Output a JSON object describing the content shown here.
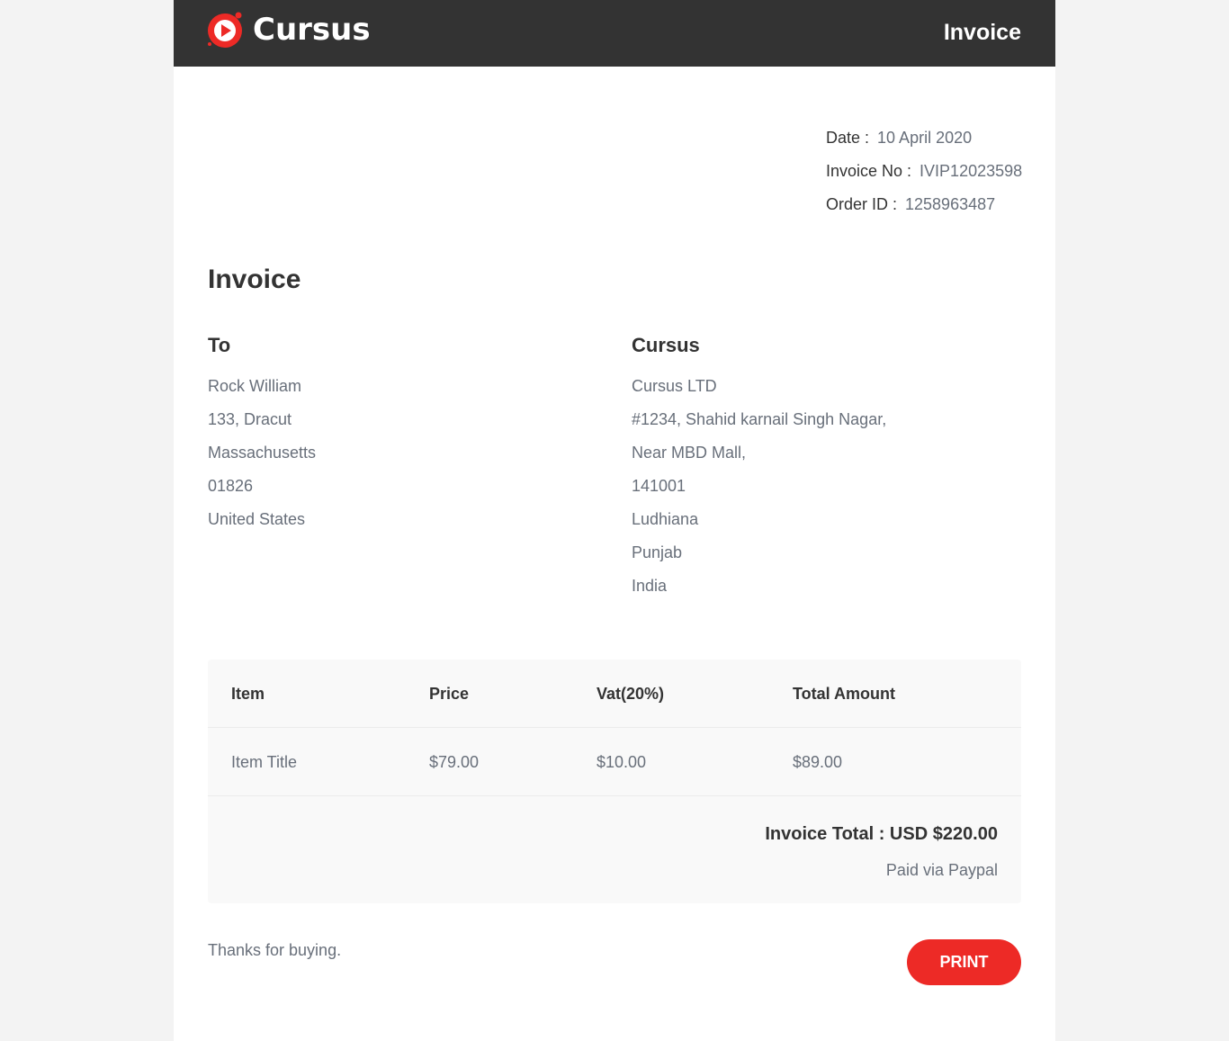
{
  "header": {
    "brand": "Cursus",
    "title": "Invoice",
    "logo_icon": "play-circle-icon",
    "accent_color": "#ed2a26",
    "bar_color": "#333333"
  },
  "meta": {
    "date_label": "Date :",
    "date_value": "10 April 2020",
    "invoice_no_label": "Invoice No :",
    "invoice_no_value": "IVIP12023598",
    "order_id_label": "Order ID :",
    "order_id_value": "1258963487"
  },
  "heading": "Invoice",
  "to": {
    "title": "To",
    "lines": [
      "Rock William",
      "133, Dracut",
      "Massachusetts",
      "01826",
      "United States"
    ]
  },
  "from": {
    "title": "Cursus",
    "lines": [
      "Cursus LTD",
      "#1234, Shahid karnail Singh Nagar,",
      "Near MBD Mall,",
      "141001",
      "Ludhiana",
      "Punjab",
      "India"
    ]
  },
  "table": {
    "headers": [
      "Item",
      "Price",
      "Vat(20%)",
      "Total Amount"
    ],
    "rows": [
      [
        "Item Title",
        "$79.00",
        "$10.00",
        "$89.00"
      ]
    ],
    "total": "Invoice Total : USD $220.00",
    "paid": "Paid via Paypal"
  },
  "footer": {
    "thanks": "Thanks for buying.",
    "print_label": "PRINT"
  }
}
